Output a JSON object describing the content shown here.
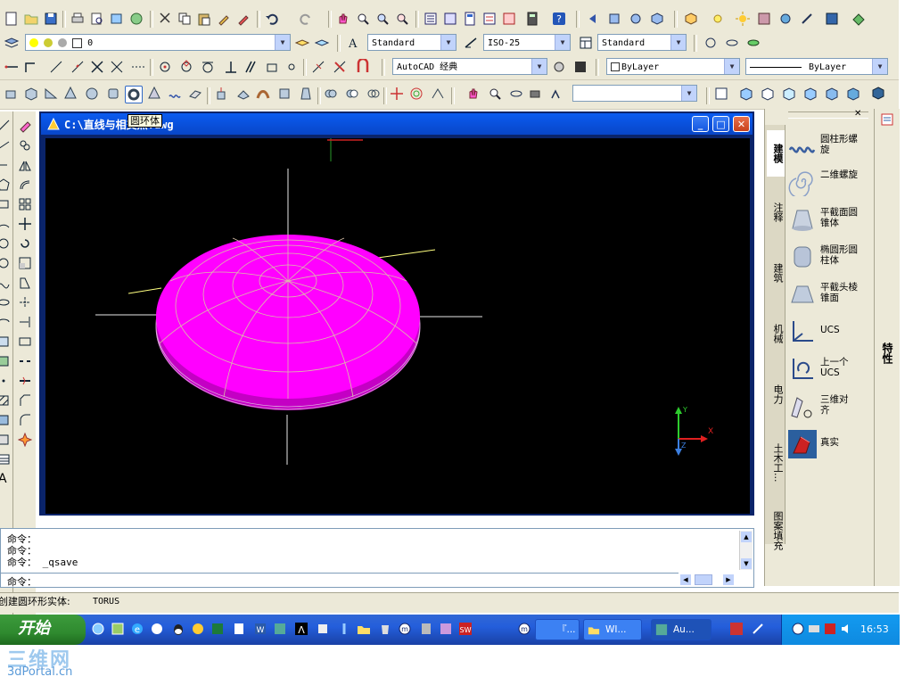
{
  "toolbar": {
    "layer_value": "0",
    "text_style": "Standard",
    "dim_style": "ISO-25",
    "table_style": "Standard",
    "workspace": "AutoCAD 经典",
    "color": "ByLayer",
    "linetype": "ByLayer",
    "view_combo": ""
  },
  "tooltip": "圆环体",
  "drawing_window": {
    "title": "C:\\直线与相交点.dwg",
    "minimize": "_",
    "maximize": "□",
    "close": "✕"
  },
  "ucs_icon": {
    "x_label": "X",
    "y_label": "Y",
    "z_label": "Z"
  },
  "tool_palette": {
    "tabs": [
      "建模",
      "注释",
      "建筑",
      "机械",
      "电力",
      "土木工...",
      "图案填充"
    ],
    "properties_tab": "特性",
    "items": [
      {
        "label": "圆柱形螺旋",
        "icon": "helix-icon"
      },
      {
        "label": "二维螺旋",
        "icon": "spiral-icon"
      },
      {
        "label": "平截面圆锥体",
        "icon": "frustum-cone-icon"
      },
      {
        "label": "椭圆形圆柱体",
        "icon": "elliptic-cylinder-icon"
      },
      {
        "label": "平截头棱锥面",
        "icon": "frustum-pyramid-icon"
      },
      {
        "label": "UCS",
        "icon": "ucs-icon"
      },
      {
        "label": "上一个UCS",
        "icon": "ucs-previous-icon"
      },
      {
        "label": "三维对齐",
        "icon": "3d-align-icon"
      },
      {
        "label": "真实",
        "icon": "realistic-style-icon"
      }
    ]
  },
  "command": {
    "history": [
      "命令：",
      "命令：",
      "命令：  _qsave"
    ],
    "prompt": "命令："
  },
  "status_bar": {
    "text": "创建圆环形实体:",
    "command_name": "TORUS"
  },
  "taskbar": {
    "start_label": "开始",
    "tasks": [
      "『...",
      "WI...",
      "Au..."
    ],
    "time": "16:53"
  },
  "watermark": {
    "cn": "三维网",
    "en": "3dPortal.cn"
  },
  "colors": {
    "model": "#ff00ff",
    "viewport_bg": "#000000",
    "xp_blue": "#0a5bf0"
  }
}
